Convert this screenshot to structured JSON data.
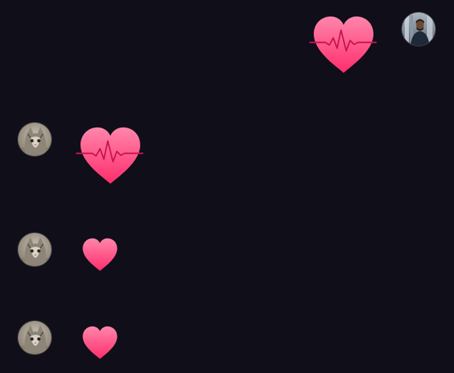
{
  "colors": {
    "background": "#0f0e19",
    "heart_top": "#ff7fa6",
    "heart_bottom": "#ff2f6e",
    "pulse_line": "#c8154f"
  },
  "messages": [
    {
      "sender": "me",
      "avatar": "man-photo",
      "content": "heartbeat-heart",
      "size": "large"
    },
    {
      "sender": "other",
      "avatar": "cat-photo",
      "content": "heartbeat-heart",
      "size": "large"
    },
    {
      "sender": "other",
      "avatar": "cat-photo",
      "content": "heart",
      "size": "small"
    },
    {
      "sender": "other",
      "avatar": "cat-photo",
      "content": "heart",
      "size": "small"
    }
  ]
}
